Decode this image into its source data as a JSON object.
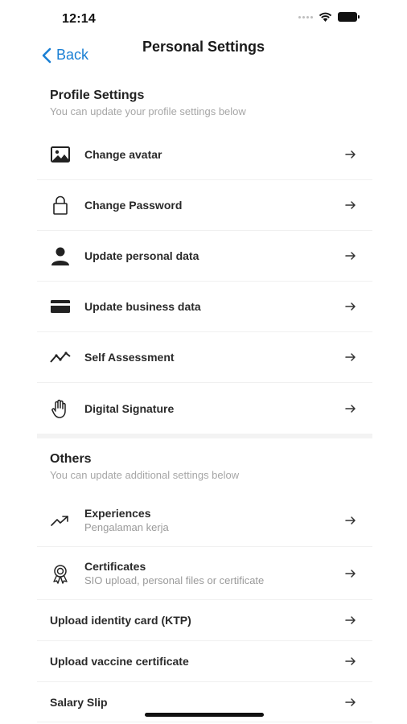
{
  "status": {
    "time": "12:14"
  },
  "nav": {
    "back_label": "Back",
    "title": "Personal Settings"
  },
  "profile_section": {
    "title": "Profile Settings",
    "subtitle": "You can update your profile settings below",
    "items": [
      {
        "label": "Change avatar",
        "icon": "image-icon"
      },
      {
        "label": "Change Password",
        "icon": "lock-icon"
      },
      {
        "label": "Update personal data",
        "icon": "person-icon"
      },
      {
        "label": "Update business data",
        "icon": "card-icon"
      },
      {
        "label": "Self Assessment",
        "icon": "trend-line-icon"
      },
      {
        "label": "Digital Signature",
        "icon": "hand-icon"
      }
    ]
  },
  "others_section": {
    "title": "Others",
    "subtitle": "You can update additional settings below",
    "items": [
      {
        "label": "Experiences",
        "sub": "Pengalaman kerja",
        "icon": "trending-up-icon"
      },
      {
        "label": "Certificates",
        "sub": "SIO upload, personal files or certificate",
        "icon": "award-icon"
      },
      {
        "label": "Upload identity card (KTP)"
      },
      {
        "label": "Upload vaccine certificate"
      },
      {
        "label": "Salary Slip"
      }
    ]
  }
}
